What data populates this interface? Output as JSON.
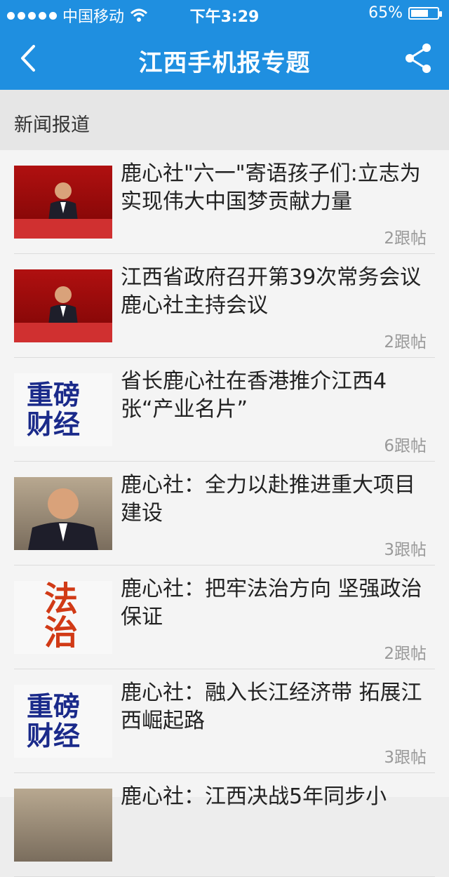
{
  "status_bar": {
    "carrier": "中国移动",
    "time": "下午3:29",
    "battery": "65%",
    "battery_level": 0.65,
    "signal_icon": "signal-dots-icon",
    "wifi_icon": "wifi-icon"
  },
  "nav": {
    "title": "江西手机报专题",
    "back_icon": "chevron-left-icon",
    "share_icon": "share-icon"
  },
  "section": {
    "label": "新闻报道"
  },
  "items": [
    {
      "title": "鹿心社\"六一\"寄语孩子们:立志为实现伟大中国梦贡献力量",
      "comments": "2跟帖",
      "thumb": "official"
    },
    {
      "title": "江西省政府召开第39次常务会议 鹿心社主持会议",
      "comments": "2跟帖",
      "thumb": "official"
    },
    {
      "title": "省长鹿心社在香港推介江西4张“产业名片”",
      "comments": "6跟帖",
      "thumb": "finance"
    },
    {
      "title": "鹿心社：全力以赴推进重大项目建设",
      "comments": "3跟帖",
      "thumb": "portrait"
    },
    {
      "title": "鹿心社：把牢法治方向   坚强政治保证",
      "comments": "2跟帖",
      "thumb": "law"
    },
    {
      "title": "鹿心社：融入长江经济带  拓展江西崛起路",
      "comments": "3跟帖",
      "thumb": "finance"
    },
    {
      "title": "鹿心社：江西决战5年同步小",
      "comments": "",
      "thumb": "portrait"
    }
  ],
  "thumb_text": {
    "finance": "重磅\n财经",
    "law": "法治"
  },
  "colors": {
    "header": "#1f8fe0",
    "background": "#ededed"
  }
}
